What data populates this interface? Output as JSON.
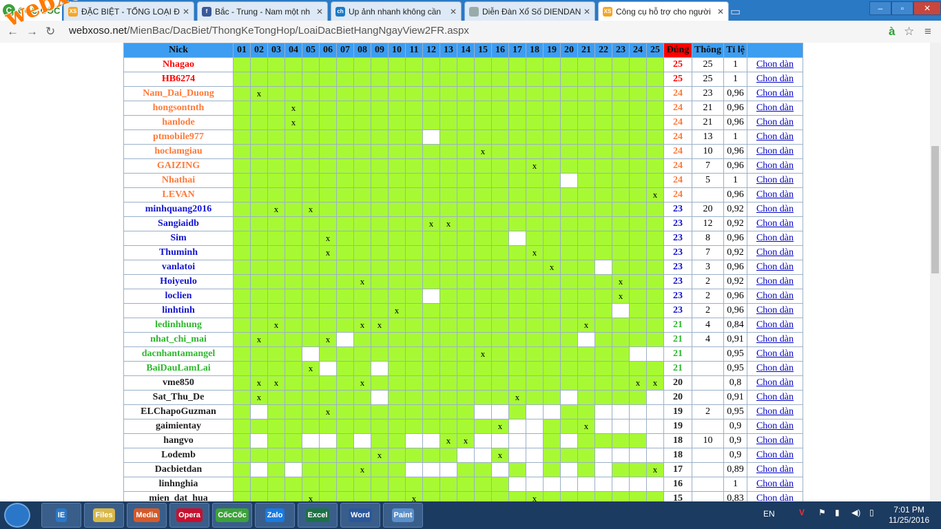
{
  "browser": {
    "brand": "CỐC CỐC",
    "tabs": [
      {
        "title": "ĐẶC BIỆT - TỔNG LOẠI ĐẶ",
        "icon_text": "XS",
        "icon_color": "#f5a623",
        "active": false
      },
      {
        "title": "Bắc - Trung - Nam một nh",
        "icon_text": "f",
        "icon_color": "#3b5998",
        "active": false
      },
      {
        "title": "Up ảnh nhanh không cần",
        "icon_text": "ch",
        "icon_color": "#1a7ac7",
        "active": false
      },
      {
        "title": "Diễn Đàn Xổ Số DIENDAN",
        "icon_text": "",
        "icon_color": "#9aa",
        "active": false
      },
      {
        "title": "Công cụ hỗ trợ cho người",
        "icon_text": "XS",
        "icon_color": "#f5a623",
        "active": true
      }
    ],
    "url_host": "webxoso.net",
    "url_path": "/MienBac/DacBiet/ThongKeTongHop/LoaiDacBietHangNgayView2FR.aspx",
    "watermark": "webxoso.net"
  },
  "table": {
    "headers": {
      "nick": "Nick",
      "dung": "Đúng",
      "thong": "Thông",
      "tile": "Tỉ lệ"
    },
    "cols": [
      "01",
      "02",
      "03",
      "04",
      "05",
      "06",
      "07",
      "08",
      "09",
      "10",
      "11",
      "12",
      "13",
      "14",
      "15",
      "16",
      "17",
      "18",
      "19",
      "20",
      "21",
      "22",
      "23",
      "24",
      "25"
    ],
    "link_label": "Chon dàn",
    "rows": [
      {
        "nick": "Nhagao",
        "cls": "red",
        "x": [],
        "w": [],
        "dung": "25",
        "thong": "25",
        "tile": "1"
      },
      {
        "nick": "HB6274",
        "cls": "red",
        "x": [],
        "w": [],
        "dung": "25",
        "thong": "25",
        "tile": "1"
      },
      {
        "nick": "Nam_Dai_Duong",
        "cls": "org",
        "x": [
          2
        ],
        "w": [],
        "dung": "24",
        "thong": "23",
        "tile": "0,96"
      },
      {
        "nick": "hongsontnth",
        "cls": "org",
        "x": [
          4
        ],
        "w": [],
        "dung": "24",
        "thong": "21",
        "tile": "0,96"
      },
      {
        "nick": "hanlode",
        "cls": "org",
        "x": [
          4
        ],
        "w": [],
        "dung": "24",
        "thong": "21",
        "tile": "0,96"
      },
      {
        "nick": "ptmobile977",
        "cls": "org",
        "x": [],
        "w": [
          12
        ],
        "dung": "24",
        "thong": "13",
        "tile": "1"
      },
      {
        "nick": "hoclamgiau",
        "cls": "org",
        "x": [
          15
        ],
        "w": [],
        "dung": "24",
        "thong": "10",
        "tile": "0,96"
      },
      {
        "nick": "GAIZING",
        "cls": "org",
        "x": [
          18
        ],
        "w": [],
        "dung": "24",
        "thong": "7",
        "tile": "0,96"
      },
      {
        "nick": "Nhathai",
        "cls": "org",
        "x": [],
        "w": [
          20
        ],
        "dung": "24",
        "thong": "5",
        "tile": "1"
      },
      {
        "nick": "LEVAN",
        "cls": "org",
        "x": [
          25
        ],
        "w": [],
        "dung": "24",
        "thong": "",
        "tile": "0,96"
      },
      {
        "nick": "minhquang2016",
        "cls": "blu",
        "x": [
          3,
          5
        ],
        "w": [],
        "dung": "23",
        "thong": "20",
        "tile": "0,92"
      },
      {
        "nick": "Sangiaidb",
        "cls": "blu",
        "x": [
          12,
          13
        ],
        "w": [],
        "dung": "23",
        "thong": "12",
        "tile": "0,92"
      },
      {
        "nick": "Sim",
        "cls": "blu",
        "x": [
          6
        ],
        "w": [
          17
        ],
        "dung": "23",
        "thong": "8",
        "tile": "0,96"
      },
      {
        "nick": "Thuminh",
        "cls": "blu",
        "x": [
          6,
          18
        ],
        "w": [],
        "dung": "23",
        "thong": "7",
        "tile": "0,92"
      },
      {
        "nick": "vanlatoi",
        "cls": "blu",
        "x": [
          19
        ],
        "w": [
          22
        ],
        "dung": "23",
        "thong": "3",
        "tile": "0,96"
      },
      {
        "nick": "Hoiyeulo",
        "cls": "blu",
        "x": [
          8,
          23
        ],
        "w": [],
        "dung": "23",
        "thong": "2",
        "tile": "0,92"
      },
      {
        "nick": "loclien",
        "cls": "blu",
        "x": [
          23
        ],
        "w": [
          12
        ],
        "dung": "23",
        "thong": "2",
        "tile": "0,96"
      },
      {
        "nick": "linhtinh",
        "cls": "blu",
        "x": [
          10
        ],
        "w": [
          23
        ],
        "dung": "23",
        "thong": "2",
        "tile": "0,96"
      },
      {
        "nick": "ledinhhung",
        "cls": "grn",
        "x": [
          3,
          8,
          9,
          21
        ],
        "w": [],
        "dung": "21",
        "thong": "4",
        "tile": "0,84"
      },
      {
        "nick": "nhat_chi_mai",
        "cls": "grn",
        "x": [
          2,
          6
        ],
        "w": [
          7,
          21
        ],
        "dung": "21",
        "thong": "4",
        "tile": "0,91"
      },
      {
        "nick": "dacnhantamangel",
        "cls": "grn",
        "x": [
          15
        ],
        "w": [
          5,
          24,
          25
        ],
        "dung": "21",
        "thong": "",
        "tile": "0,95"
      },
      {
        "nick": "BaiDauLamLai",
        "cls": "grn",
        "x": [
          5
        ],
        "w": [
          6,
          9
        ],
        "dung": "21",
        "thong": "",
        "tile": "0,95"
      },
      {
        "nick": "vme850",
        "cls": "blk",
        "x": [
          2,
          3,
          8,
          24,
          25
        ],
        "w": [],
        "dung": "20",
        "thong": "",
        "tile": "0,8"
      },
      {
        "nick": "Sat_Thu_De",
        "cls": "blk",
        "x": [
          2,
          17
        ],
        "w": [
          9,
          20,
          25
        ],
        "dung": "20",
        "thong": "",
        "tile": "0,91"
      },
      {
        "nick": "ELChapoGuzman",
        "cls": "blk",
        "x": [
          6
        ],
        "w": [
          2,
          15,
          16,
          18,
          19,
          22,
          23,
          24,
          25
        ],
        "dung": "19",
        "thong": "2",
        "tile": "0,95"
      },
      {
        "nick": "gaimientay",
        "cls": "blk",
        "x": [
          16,
          21
        ],
        "w": [
          17,
          18,
          22,
          23,
          24,
          25
        ],
        "dung": "19",
        "thong": "",
        "tile": "0,9"
      },
      {
        "nick": "hangvo",
        "cls": "blk",
        "x": [
          13,
          14
        ],
        "w": [
          2,
          5,
          6,
          8,
          11,
          12,
          15,
          16,
          17,
          18,
          20,
          25
        ],
        "dung": "18",
        "thong": "10",
        "tile": "0,9"
      },
      {
        "nick": "Lodemb",
        "cls": "blk",
        "x": [
          9,
          16
        ],
        "w": [
          14,
          15,
          17,
          18,
          22,
          23,
          24,
          25
        ],
        "dung": "18",
        "thong": "",
        "tile": "0,9"
      },
      {
        "nick": "Dacbietdan",
        "cls": "blk",
        "x": [
          8,
          25
        ],
        "w": [
          2,
          4,
          11,
          12,
          13,
          16,
          18,
          20,
          22
        ],
        "dung": "17",
        "thong": "",
        "tile": "0,89"
      },
      {
        "nick": "linhnghia",
        "cls": "blk",
        "x": [],
        "w": [
          17,
          18,
          19,
          20,
          21,
          22,
          23,
          24,
          25
        ],
        "dung": "16",
        "thong": "",
        "tile": "1"
      },
      {
        "nick": "mien_dat_hua",
        "cls": "blk",
        "x": [
          5,
          11,
          18
        ],
        "w": [],
        "dung": "15",
        "thong": "",
        "tile": "0,83"
      }
    ]
  },
  "taskbar": {
    "apps": [
      "IE",
      "Files",
      "Media",
      "Opera",
      "CốcCốc",
      "Zalo",
      "Excel",
      "Word",
      "Paint"
    ],
    "lang": "EN",
    "time": "7:01 PM",
    "date": "11/25/2016"
  }
}
